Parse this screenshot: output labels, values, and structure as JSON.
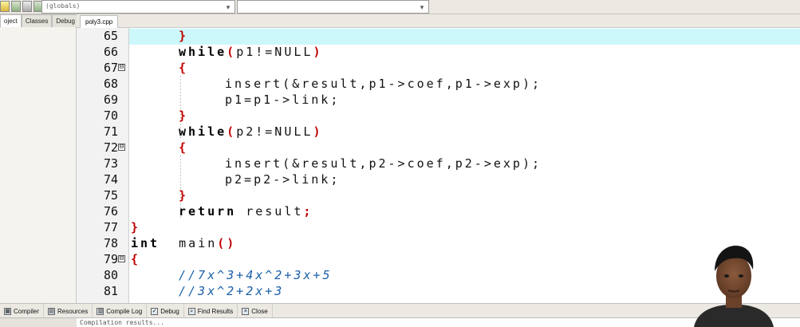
{
  "toolbar": {
    "icons": [
      "new-file-icon",
      "open-icon",
      "save-icon",
      "run-icon",
      "stop-icon"
    ],
    "scope_combo": "(globals)",
    "member_combo": ""
  },
  "left_panel": {
    "tabs": [
      "oject",
      "Classes",
      "Debug"
    ],
    "active_tab": "oject"
  },
  "editor": {
    "file_tab": "poly3.cpp",
    "highlighted_line": "65",
    "lines": [
      {
        "n": "65",
        "fold": ""
      },
      {
        "n": "66",
        "fold": ""
      },
      {
        "n": "67",
        "fold": "⊟"
      },
      {
        "n": "68",
        "fold": ""
      },
      {
        "n": "69",
        "fold": ""
      },
      {
        "n": "70",
        "fold": ""
      },
      {
        "n": "71",
        "fold": ""
      },
      {
        "n": "72",
        "fold": "⊟"
      },
      {
        "n": "73",
        "fold": ""
      },
      {
        "n": "74",
        "fold": ""
      },
      {
        "n": "75",
        "fold": ""
      },
      {
        "n": "76",
        "fold": ""
      },
      {
        "n": "77",
        "fold": ""
      },
      {
        "n": "78",
        "fold": ""
      },
      {
        "n": "79",
        "fold": "⊟"
      },
      {
        "n": "80",
        "fold": ""
      },
      {
        "n": "81",
        "fold": ""
      }
    ],
    "code": {
      "l65": "}",
      "l66_kw": "while",
      "l66_rest": "p1!=NULL",
      "l67": "{",
      "l68": "insert(&result,p1->coef,p1->exp);",
      "l69": "p1=p1->link;",
      "l70": "}",
      "l71_kw": "while",
      "l71_rest": "p2!=NULL",
      "l72": "{",
      "l73": "insert(&result,p2->coef,p2->exp);",
      "l74": "p2=p2->link;",
      "l75": "}",
      "l76_kw": "return",
      "l76_rest": "result",
      "l77": "}",
      "l78_kw": "int",
      "l78_rest": "main",
      "l79": "{",
      "l80": "//7x^3+4x^2+3x+5",
      "l81": "//3x^2+2x+3"
    }
  },
  "bottom_tabs": [
    {
      "label": "Compiler",
      "icon": "compiler-icon"
    },
    {
      "label": "Resources",
      "icon": "resources-icon"
    },
    {
      "label": "Compile Log",
      "icon": "compile-log-icon"
    },
    {
      "label": "Debug",
      "icon": "debug-icon"
    },
    {
      "label": "Find Results",
      "icon": "find-results-icon"
    },
    {
      "label": "Close",
      "icon": "close-icon"
    }
  ],
  "output": {
    "text": "Compilation results..."
  }
}
